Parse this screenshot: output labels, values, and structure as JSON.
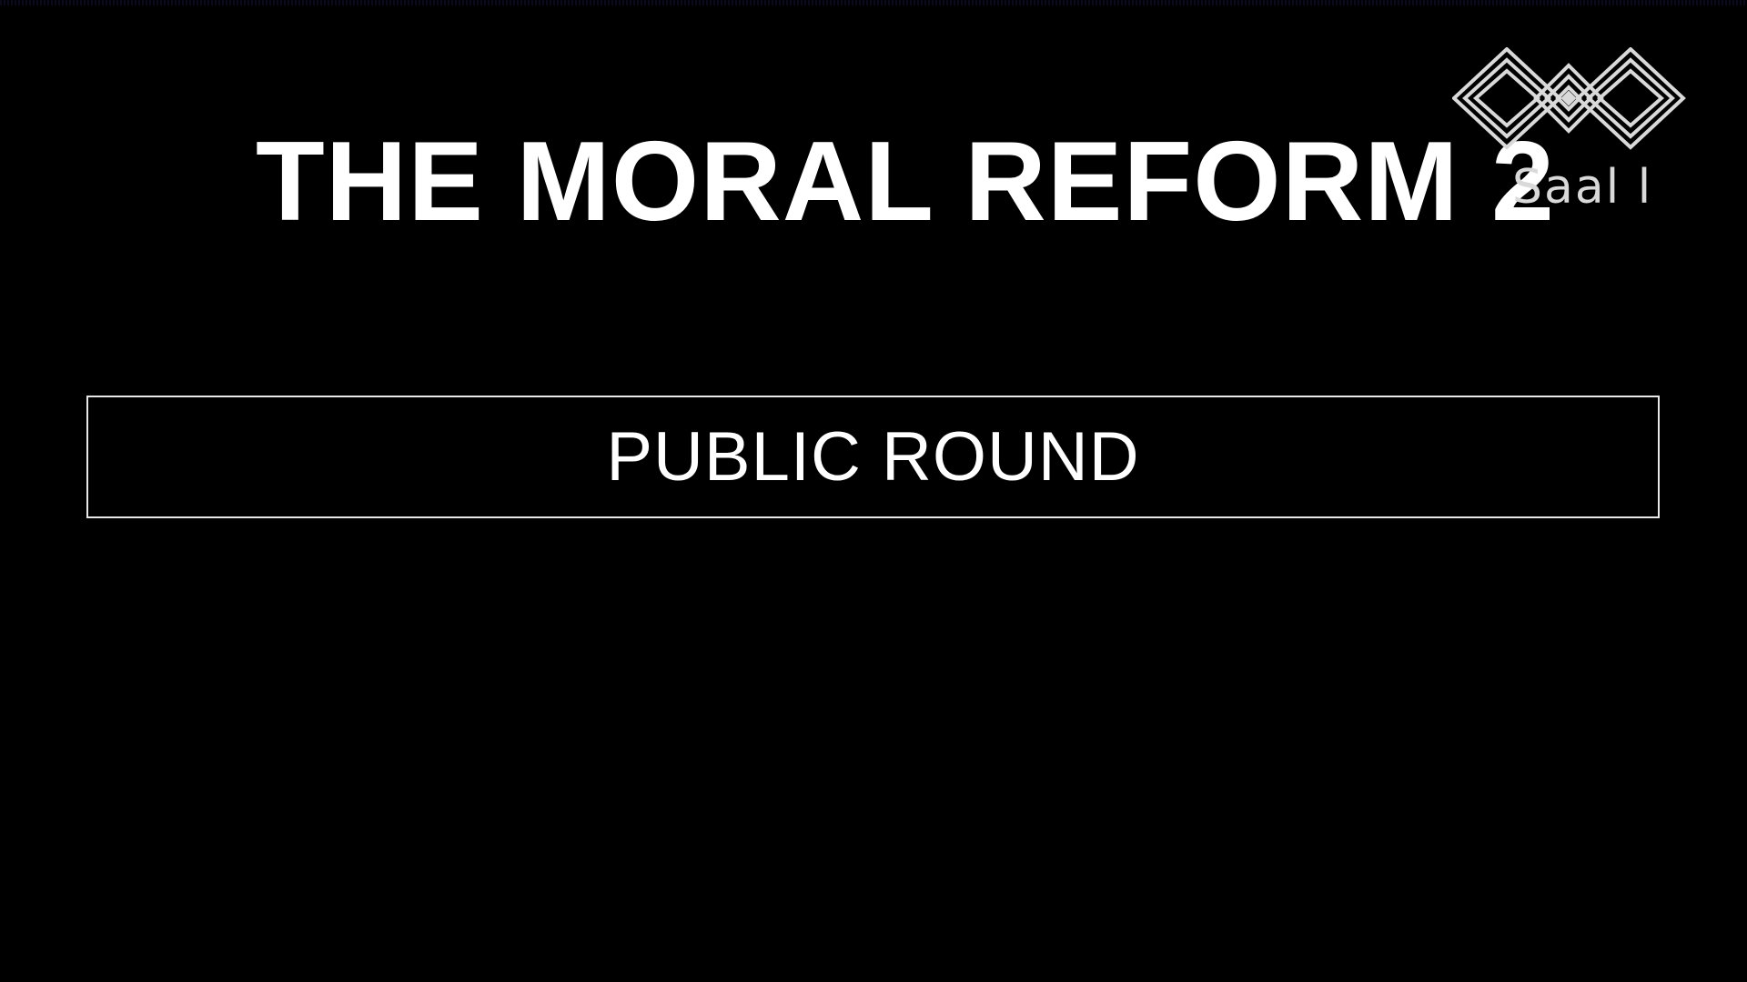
{
  "slide": {
    "title": "THE MORAL REFORM 2",
    "round_label": "PUBLIC ROUND"
  },
  "watermark": {
    "icon": "channel-logo-icon",
    "text": "Saal l"
  },
  "colors": {
    "background": "#000000",
    "text": "#ffffff",
    "border": "#e8e8e8",
    "logo": "#d9d9d9"
  }
}
